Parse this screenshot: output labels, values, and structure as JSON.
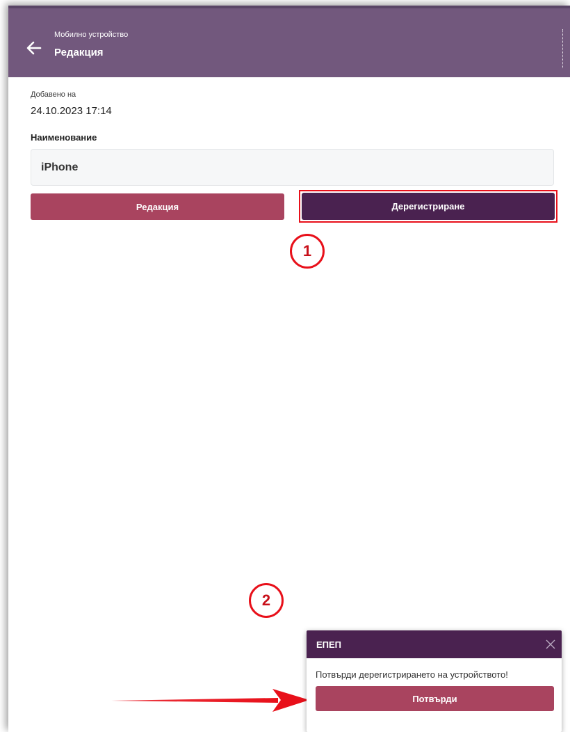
{
  "colors": {
    "appbar": "#72587d",
    "primary_dark": "#4a2250",
    "accent": "#a9445f",
    "annotation_red": "#e8101a"
  },
  "header": {
    "subtitle": "Мобилно устройство",
    "title": "Редакция",
    "back_icon": "arrow-left-icon",
    "menu_icon": "vertical-dots-divider"
  },
  "details": {
    "added_label": "Добавено на",
    "added_value": "24.10.2023 17:14",
    "name_label": "Наименование",
    "name_value": "iPhone"
  },
  "actions": {
    "edit_label": "Редакция",
    "deregister_label": "Дерегистриране"
  },
  "annotations": {
    "step1": "1",
    "step2": "2"
  },
  "toast": {
    "title": "ЕПЕП",
    "close_icon": "close-icon",
    "message": "Потвърди дерегистрирането на устройството!",
    "confirm_label": "Потвърди"
  }
}
